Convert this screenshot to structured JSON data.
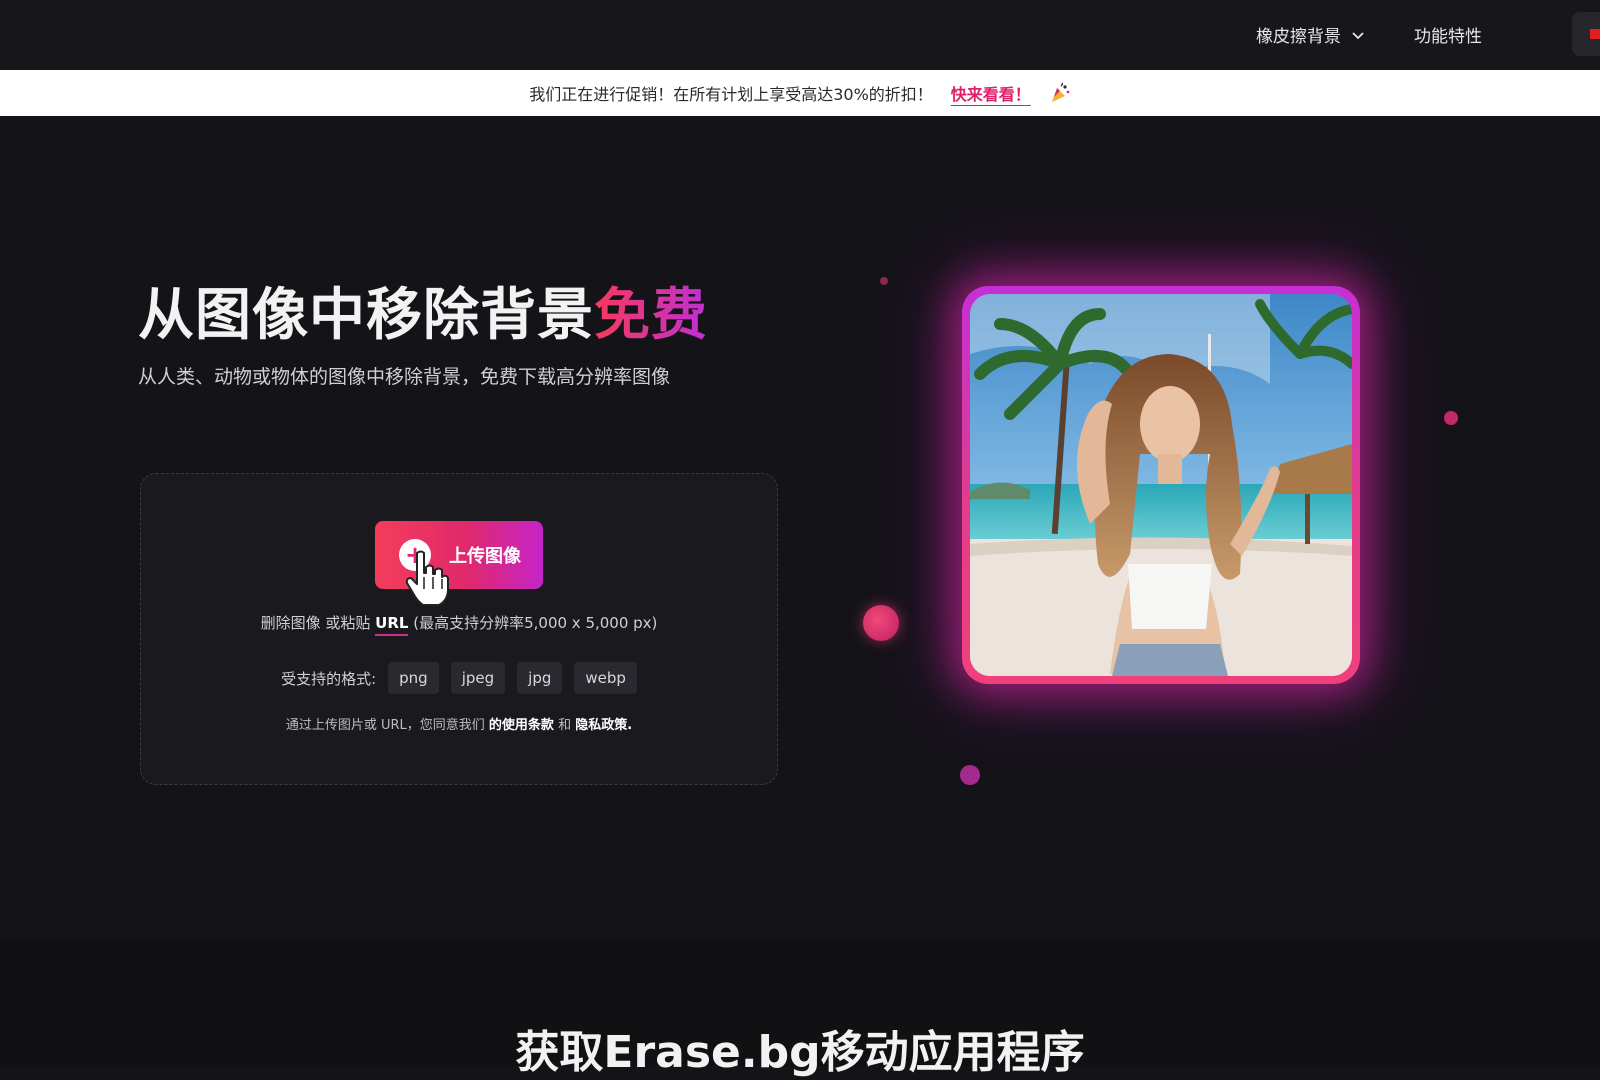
{
  "nav": {
    "items": [
      {
        "label": "橡皮擦背景",
        "has_dropdown": true
      },
      {
        "label": "功能特性",
        "has_dropdown": false
      }
    ]
  },
  "promo": {
    "text": "我们正在进行促销！在所有计划上享受高达30%的折扣！",
    "link": "快来看看！"
  },
  "hero": {
    "title_main": "从图像中移除背景",
    "title_accent": "免费",
    "subtitle": "从人类、动物或物体的图像中移除背景，免费下载高分辨率图像"
  },
  "upload": {
    "button_label": "上传图像",
    "hint_prefix": "删除图像 或粘贴",
    "hint_link": "URL",
    "hint_suffix": "(最高支持分辨率5,000 x 5,000 px)",
    "formats_label": "受支持的格式:",
    "formats": [
      "png",
      "jpeg",
      "jpg",
      "webp"
    ],
    "terms_prefix": "通过上传图片或 URL，您同意我们",
    "terms_link": "的使用条款",
    "terms_and": "和",
    "privacy_link": "隐私政策."
  },
  "bottom": {
    "title": "获取Erase.bg移动应用程序"
  },
  "colors": {
    "accent_pink": "#f0306a",
    "accent_purple": "#c524c8",
    "background": "#141318"
  }
}
